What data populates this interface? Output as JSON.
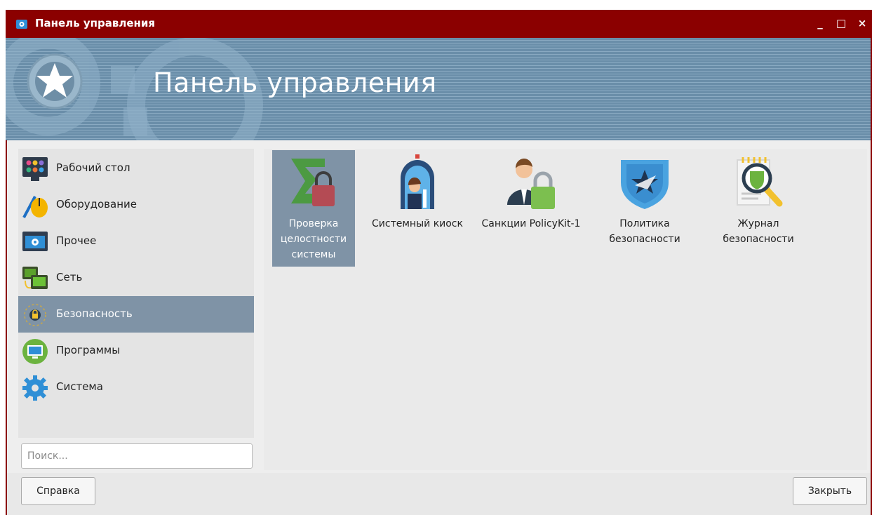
{
  "window": {
    "title": "Панель управления",
    "title_icon": "control-panel-icon",
    "minimize_symbol": "_",
    "maximize_symbol": "□",
    "close_symbol": "×",
    "titlebar_color": "#8b0000"
  },
  "banner": {
    "title": "Панель управления",
    "icon": "star-gear-icon",
    "color": "#6a8ea9"
  },
  "sidebar": {
    "items": [
      {
        "label": "Рабочий стол",
        "icon": "desktop-icon"
      },
      {
        "label": "Оборудование",
        "icon": "hardware-mouse-icon"
      },
      {
        "label": "Прочее",
        "icon": "other-settings-icon"
      },
      {
        "label": "Сеть",
        "icon": "network-icon"
      },
      {
        "label": "Безопасность",
        "icon": "security-icon",
        "selected": true
      },
      {
        "label": "Программы",
        "icon": "programs-icon"
      },
      {
        "label": "Система",
        "icon": "system-gear-icon"
      }
    ],
    "selection_color": "#7f93a6"
  },
  "search": {
    "placeholder": "Поиск...",
    "value": ""
  },
  "main": {
    "tiles": [
      {
        "label": "Проверка\nцелостности\nсистемы",
        "icon": "integrity-check-icon",
        "selected": true
      },
      {
        "label": "Системный киоск",
        "icon": "kiosk-icon"
      },
      {
        "label": "Санкции PolicyKit-1",
        "icon": "policykit-icon"
      },
      {
        "label": "Политика\nбезопасности",
        "icon": "security-policy-icon"
      },
      {
        "label": "Журнал\nбезопасности",
        "icon": "security-log-icon"
      }
    ]
  },
  "footer": {
    "help_label": "Справка",
    "close_label": "Закрыть"
  }
}
